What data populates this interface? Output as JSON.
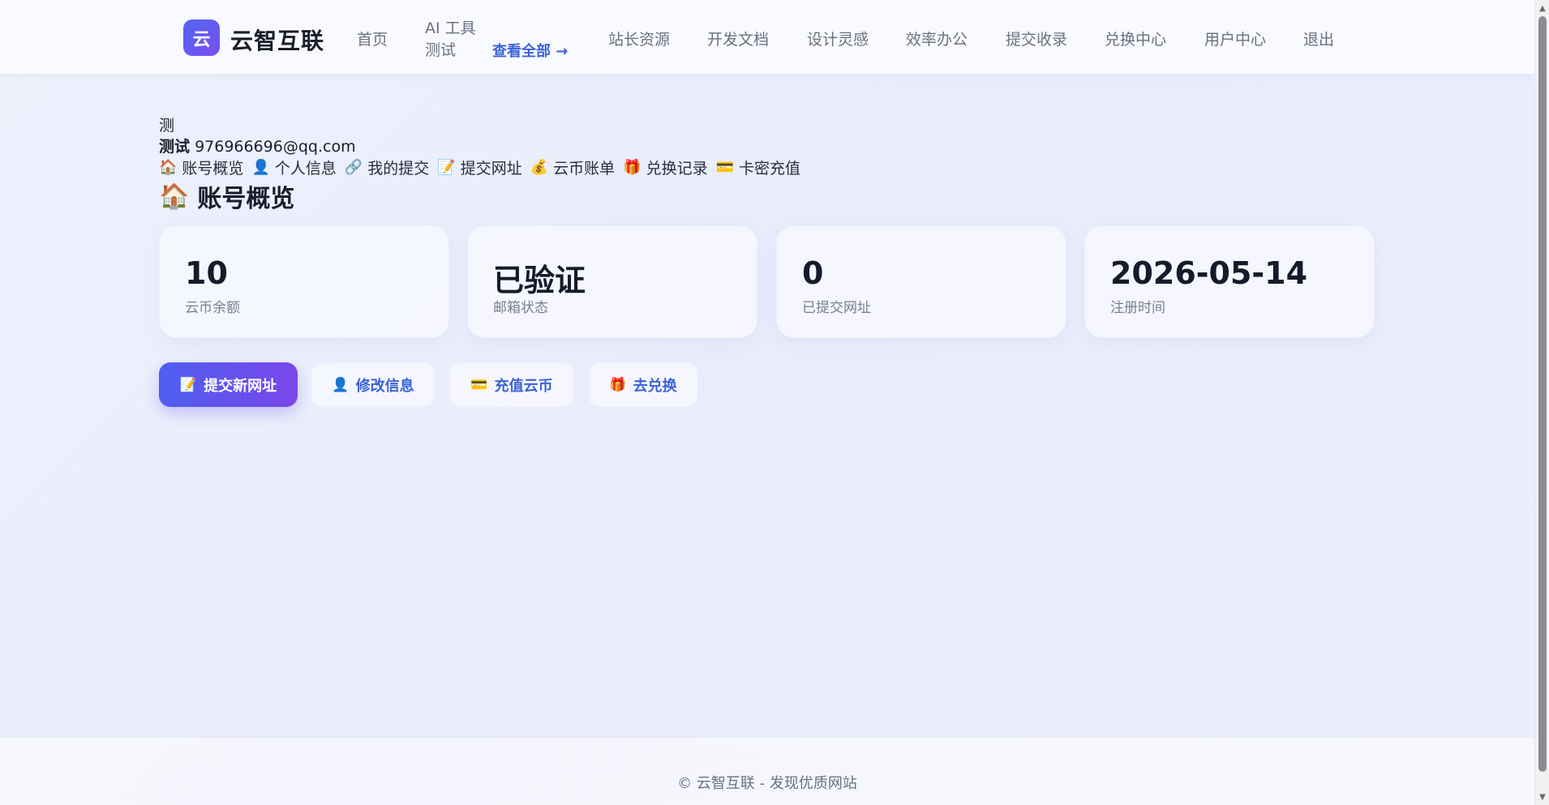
{
  "header": {
    "logo_mark": "云",
    "logo_text": "云智互联",
    "nav": {
      "home": "首页",
      "ai_tools": "AI 工具\n测试",
      "view_all": "查看全部 →",
      "webmaster": "站长资源",
      "dev_docs": "开发文档",
      "design": "设计灵感",
      "office": "效率办公",
      "submit": "提交收录",
      "exchange": "兑换中心",
      "user_center": "用户中心",
      "logout": "退出"
    }
  },
  "user": {
    "avatar_text": "测",
    "name": "测试",
    "email": "976966696@qq.com",
    "menu": {
      "overview": {
        "icon": "🏠",
        "label": "账号概览"
      },
      "profile": {
        "icon": "👤",
        "label": "个人信息"
      },
      "my_submissions": {
        "icon": "🔗",
        "label": "我的提交"
      },
      "submit_url": {
        "icon": "📝",
        "label": "提交网址"
      },
      "coin_bill": {
        "icon": "💰",
        "label": "云币账单"
      },
      "exchange_records": {
        "icon": "🎁",
        "label": "兑换记录"
      },
      "card_recharge": {
        "icon": "💳",
        "label": "卡密充值"
      }
    }
  },
  "overview": {
    "title_icon": "🏠",
    "title": "账号概览",
    "stats": {
      "coins": {
        "value": "10",
        "label": "云币余额"
      },
      "email": {
        "value": "已验证",
        "label": "邮箱状态"
      },
      "submitted": {
        "value": "0",
        "label": "已提交网址"
      },
      "registered": {
        "value": "2026-05-14",
        "label": "注册时间"
      }
    }
  },
  "actions": {
    "submit_new": {
      "icon": "📝",
      "label": "提交新网址"
    },
    "edit_info": {
      "icon": "👤",
      "label": "修改信息"
    },
    "recharge": {
      "icon": "💳",
      "label": "充值云币"
    },
    "redeem": {
      "icon": "🎁",
      "label": "去兑换"
    }
  },
  "footer": {
    "text": "© 云智互联 - 发现优质网站"
  },
  "colors": {
    "accent": "#3b63d6",
    "brand_gradient_start": "#4f5ff0",
    "brand_gradient_end": "#7a46ea",
    "background": "#eceefc"
  }
}
